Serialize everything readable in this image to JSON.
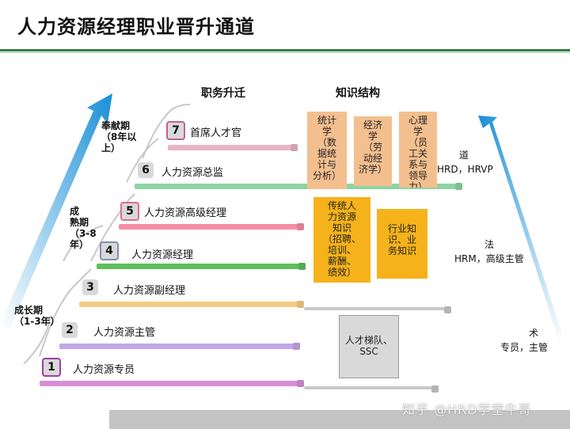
{
  "title": "人力资源经理职业晋升通道",
  "headers": {
    "career": "职务升迁",
    "knowledge": "知识结构"
  },
  "phases": {
    "contribution": "奉献期\n（8年以\n上）",
    "mature": "成\n熟期\n（3-8\n年）",
    "growth": "成长期\n（1-3年）"
  },
  "levels": [
    {
      "num": "1",
      "label": "人力资源专员"
    },
    {
      "num": "2",
      "label": "人力资源主管"
    },
    {
      "num": "3",
      "label": "人力资源副经理"
    },
    {
      "num": "4",
      "label": "人力资源经理"
    },
    {
      "num": "5",
      "label": "人力资源高级经理"
    },
    {
      "num": "6",
      "label": "人力资源总监"
    },
    {
      "num": "7",
      "label": "首席人才官"
    }
  ],
  "knowledge": {
    "statistics": "统计\n学\n（数\n据统\n计与\n分析）",
    "economics": "经济\n学\n（劳\n动经\n济学）",
    "psychology": "心理\n学\n（员\n工关\n系与\n领导\n力）",
    "traditional_hr": "传统人\n力资源\n知识\n（招聘、\n培训、\n薪酬、\n绩效）",
    "industry": "行业知\n识、业\n务知识",
    "talent": "人才梯队、\nSSC"
  },
  "side": {
    "dao_char": "道",
    "dao_roles": "HRD，HRVP",
    "fa_char": "法",
    "fa_roles": "HRM，高级主管",
    "shu_char": "术",
    "shu_roles": "专员，主管"
  },
  "watermark": "知乎 @HRD学堂牛哥",
  "colors": {
    "green_rule": "#2e7d4a",
    "orange_box": "#f4bf8f",
    "gold_box": "#f5b21a",
    "gray_box": "#d9d9d9"
  }
}
